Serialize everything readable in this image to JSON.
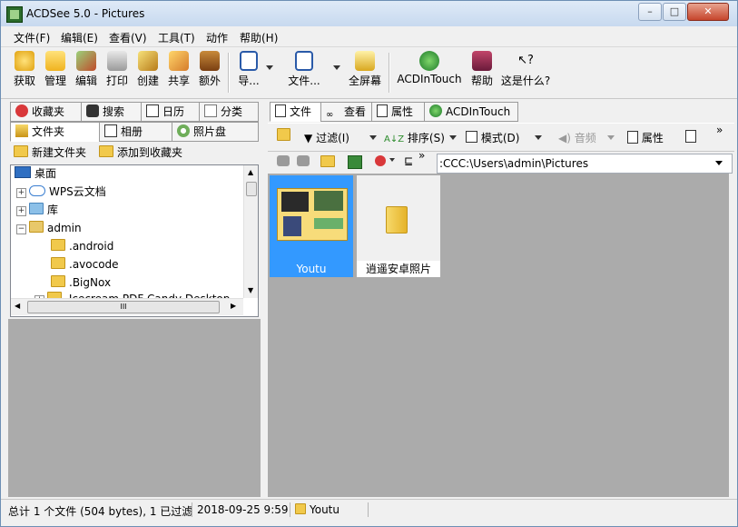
{
  "window": {
    "title": "ACDSee 5.0 - Pictures",
    "minimize": "–",
    "maximize": "□",
    "close": "✕"
  },
  "menu": [
    "文件(F)",
    "编辑(E)",
    "查看(V)",
    "工具(T)",
    "动作",
    "帮助(H)"
  ],
  "toolbar": {
    "acquire": "获取",
    "manage": "管理",
    "edit": "编辑",
    "print": "打印",
    "create": "创建",
    "share": "共享",
    "extra": "额外",
    "navigate": "导...",
    "file": "文件...",
    "fullscreen": "全屏幕",
    "acdintouch": "ACDInTouch",
    "help": "帮助",
    "whatsthis": "这是什么?"
  },
  "left_tabs_row1": [
    "收藏夹",
    "搜索",
    "日历",
    "分类"
  ],
  "left_tabs_row2": [
    "文件夹",
    "相册",
    "照片盘"
  ],
  "left_actions": {
    "new_folder": "新建文件夹",
    "add_favorite": "添加到收藏夹"
  },
  "tree": {
    "items": [
      "桌面",
      "WPS云文档",
      "库",
      "admin",
      ".android",
      ".avocode",
      ".BigNox",
      ".Icecream PDF Candy Desktop"
    ],
    "scroll_grip": "III"
  },
  "right_tabs": [
    "文件",
    "查看",
    "属性",
    "ACDInTouch"
  ],
  "right_toolbar": {
    "filter": "过滤(I)",
    "sort": "排序(S)",
    "mode": "模式(D)",
    "audio": "音频",
    "properties": "属性",
    "more": "»"
  },
  "path": {
    "value": ":CCC:\\Users\\admin\\Pictures",
    "more": "»"
  },
  "thumbnails": [
    {
      "name": "Youtu",
      "selected": true
    },
    {
      "name": "逍遥安卓照片",
      "selected": false
    }
  ],
  "status": {
    "summary": "总计 1 个文件 (504 bytes), 1 已过滤",
    "date": "2018-09-25 9:59",
    "selected": "Youtu"
  },
  "colors": {
    "selection": "#3399ff",
    "folder": "#f1c94b",
    "pane_bg": "#ababab",
    "titlebar": "#c7d9ef"
  }
}
